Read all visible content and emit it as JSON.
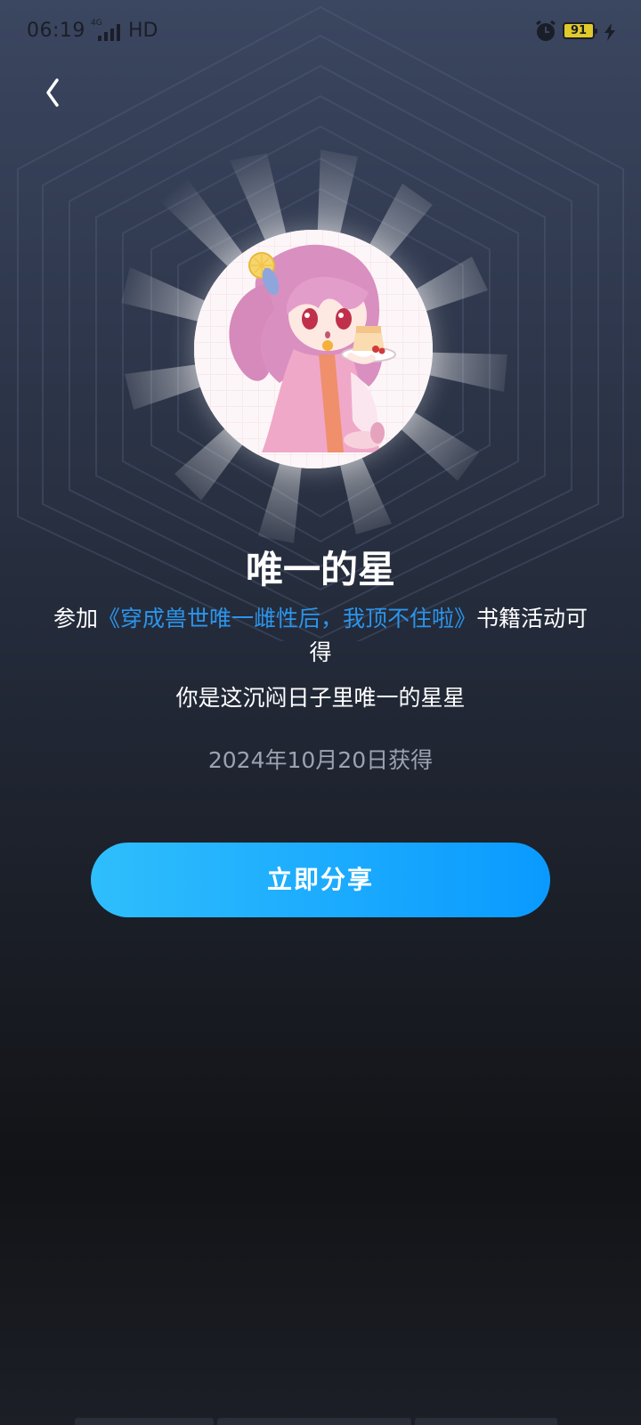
{
  "status_bar": {
    "time": "06:19",
    "network_small": "4G",
    "hd": "HD",
    "battery": "91",
    "icons": [
      "signal-icon",
      "alarm-icon",
      "battery-icon",
      "charging-icon"
    ]
  },
  "nav": {
    "back_icon": "chevron-left-icon"
  },
  "badge": {
    "title": "唯一的星",
    "desc_prefix": "参加",
    "book_title": "《穿成兽世唯一雌性后，我顶不住啦》",
    "desc_suffix": "书籍活动可得",
    "quote": "你是这沉闷日子里唯一的星星",
    "date": "2024年10月20日获得"
  },
  "actions": {
    "share_label": "立即分享"
  },
  "colors": {
    "accent": "#2b95ec",
    "button_start": "#2fbefc",
    "button_end": "#0a9aff",
    "date_gray": "#9ca3b0"
  }
}
